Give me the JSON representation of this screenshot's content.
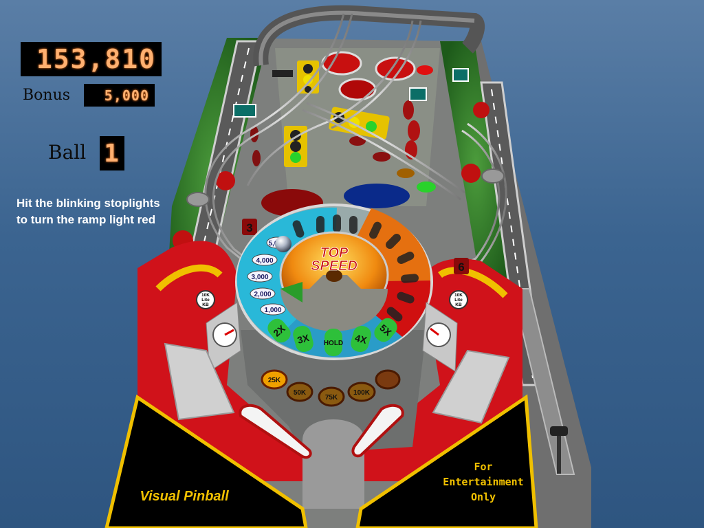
{
  "scoreboard": {
    "score": "153,810",
    "bonus_label": "Bonus",
    "bonus": "5,000",
    "ball_label": "Ball",
    "ball": "1"
  },
  "hint": "Hit the blinking stoplights to turn the ramp light red",
  "table": {
    "wheel_title_line1": "TOP",
    "wheel_title_line2": "SPEED",
    "wheel_values": [
      "5,000",
      "4,000",
      "3,000",
      "2,000",
      "1,000"
    ],
    "wheel_multipliers": [
      "2X",
      "3X",
      "HOLD",
      "4X",
      "5X"
    ],
    "bottom_targets": [
      "25K",
      "50K",
      "75K",
      "100K"
    ],
    "lane_numbers": [
      "3",
      "6"
    ],
    "lite_kb_label": [
      "10K",
      "Lite",
      "KB"
    ],
    "apron_left": "Visual Pinball",
    "apron_right": [
      "For",
      "Entertainment",
      "Only"
    ]
  },
  "colors": {
    "background": "#3b6490",
    "playfield_red": "#d0121a",
    "apron_black": "#000000",
    "apron_yellow": "#f0c000",
    "display_digits": "#ffb070"
  }
}
